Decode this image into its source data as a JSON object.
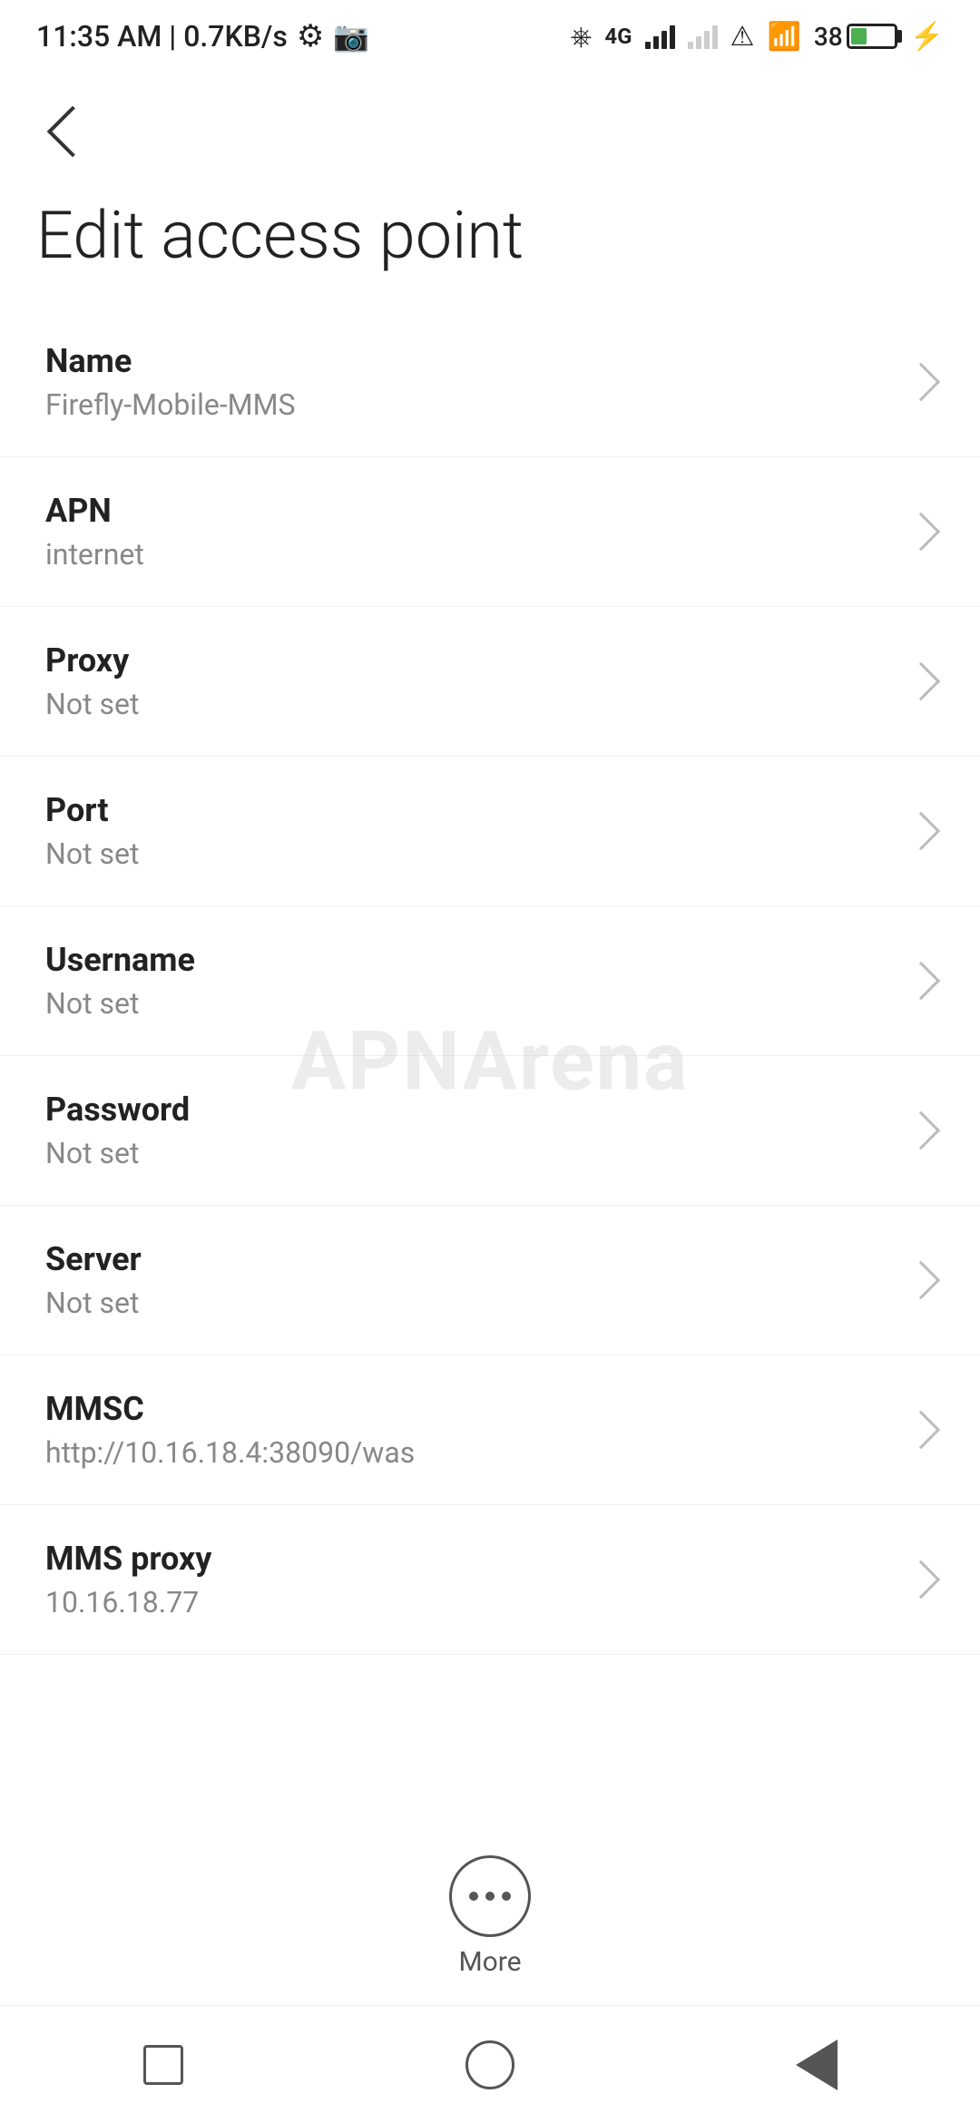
{
  "statusBar": {
    "time": "11:35 AM | 0.7KB/s",
    "batteryPercent": 38
  },
  "nav": {
    "backLabel": "Back"
  },
  "pageTitle": "Edit access point",
  "settings": [
    {
      "id": "name",
      "label": "Name",
      "value": "Firefly-Mobile-MMS"
    },
    {
      "id": "apn",
      "label": "APN",
      "value": "internet"
    },
    {
      "id": "proxy",
      "label": "Proxy",
      "value": "Not set"
    },
    {
      "id": "port",
      "label": "Port",
      "value": "Not set"
    },
    {
      "id": "username",
      "label": "Username",
      "value": "Not set"
    },
    {
      "id": "password",
      "label": "Password",
      "value": "Not set"
    },
    {
      "id": "server",
      "label": "Server",
      "value": "Not set"
    },
    {
      "id": "mmsc",
      "label": "MMSC",
      "value": "http://10.16.18.4:38090/was"
    },
    {
      "id": "mms-proxy",
      "label": "MMS proxy",
      "value": "10.16.18.77"
    }
  ],
  "more": {
    "label": "More"
  },
  "watermark": "APNArena"
}
